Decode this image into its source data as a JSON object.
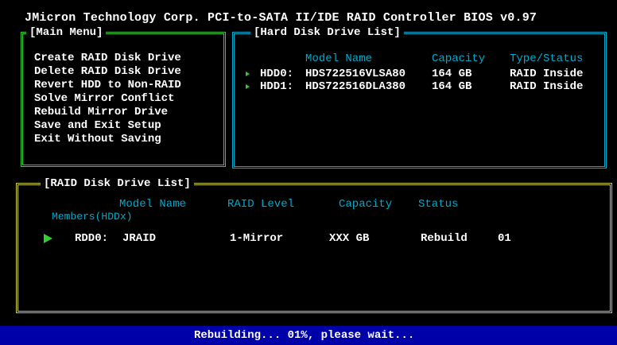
{
  "title": "JMicron Technology Corp. PCI-to-SATA II/IDE RAID Controller BIOS v0.97",
  "colors": {
    "background": "#000000",
    "main_menu_border": "#33CC33",
    "hdd_border": "#00AACC",
    "raid_border": "#CCCC33",
    "header_text": "#00AACC",
    "arrow": "#33CC33",
    "status_bar": "#0000A8"
  },
  "main_menu": {
    "title": "[Main Menu]",
    "items": [
      "Create RAID Disk Drive",
      "Delete RAID Disk Drive",
      "Revert HDD to Non-RAID",
      "Solve Mirror Conflict",
      "Rebuild Mirror Drive",
      "Save and Exit Setup",
      "Exit Without Saving"
    ]
  },
  "hdd_list": {
    "title": "[Hard Disk Drive List]",
    "headers": {
      "model": "Model Name",
      "capacity": "Capacity",
      "type_status": "Type/Status"
    },
    "rows": [
      {
        "id": "HDD0:",
        "model": "HDS722516VLSA80",
        "capacity": "164 GB",
        "type_status": "RAID Inside"
      },
      {
        "id": "HDD1:",
        "model": "HDS722516DLA380",
        "capacity": "164 GB",
        "type_status": "RAID Inside"
      }
    ]
  },
  "raid_list": {
    "title": "[RAID Disk Drive List]",
    "headers": {
      "model": "Model Name",
      "raid_level": "RAID Level",
      "capacity": "Capacity",
      "status": "Status",
      "members": "Members(HDDx)"
    },
    "rows": [
      {
        "id": "RDD0:",
        "model": "JRAID",
        "raid_level": "1-Mirror",
        "capacity": "XXX GB",
        "status": "Rebuild",
        "members": "01"
      }
    ]
  },
  "status_bar": {
    "text": "Rebuilding... 01%, please wait..."
  }
}
